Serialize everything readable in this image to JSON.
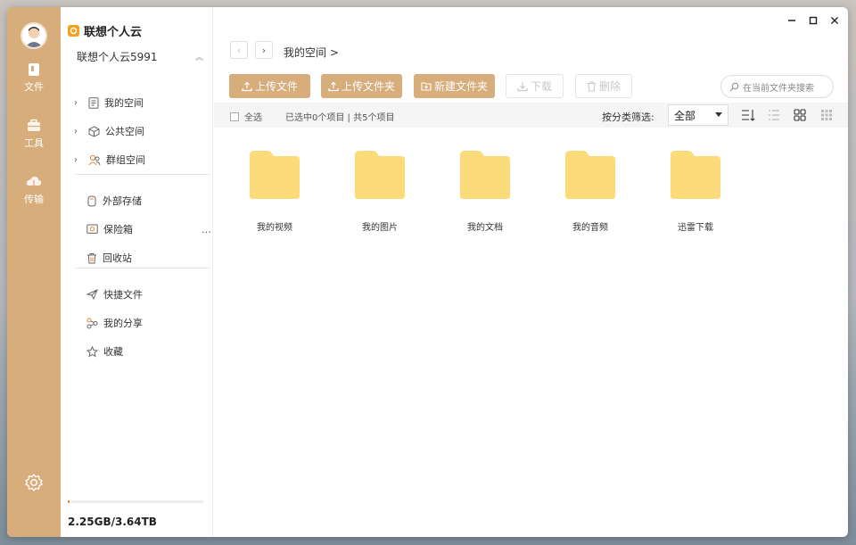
{
  "app": {
    "brand": "联想个人云",
    "account": "联想个人云5991"
  },
  "rail": [
    {
      "label": "文件",
      "icon": "file-icon"
    },
    {
      "label": "工具",
      "icon": "toolbox-icon"
    },
    {
      "label": "传输",
      "icon": "cloud-transfer-icon"
    }
  ],
  "sidebar": {
    "groups": [
      {
        "label": "我的空间",
        "icon": "document-icon"
      },
      {
        "label": "公共空间",
        "icon": "cube-icon"
      },
      {
        "label": "群组空间",
        "icon": "group-icon"
      }
    ],
    "storage_items": [
      {
        "label": "外部存储",
        "icon": "external-storage-icon"
      },
      {
        "label": "保险箱",
        "icon": "safe-icon"
      },
      {
        "label": "回收站",
        "icon": "trash-icon"
      }
    ],
    "more": "…",
    "quick_items": [
      {
        "label": "快捷文件",
        "icon": "send-icon"
      },
      {
        "label": "我的分享",
        "icon": "share-icon"
      },
      {
        "label": "收藏",
        "icon": "star-icon"
      }
    ],
    "storage": {
      "text": "2.25GB/3.64TB",
      "used_fraction": 0.006
    }
  },
  "main": {
    "breadcrumb": "我的空间 >",
    "toolbar": {
      "upload_file": "上传文件",
      "upload_folder": "上传文件夹",
      "new_folder": "新建文件夹",
      "download": "下载",
      "delete": "删除"
    },
    "search_placeholder": "在当前文件夹搜索",
    "filter": {
      "select_all": "全选",
      "selection_info": "已选中0个项目 | 共5个项目",
      "label": "按分类筛选:",
      "value": "全部"
    },
    "folders": [
      {
        "name": "我的视频"
      },
      {
        "name": "我的图片"
      },
      {
        "name": "我的文档"
      },
      {
        "name": "我的音频"
      },
      {
        "name": "迅雷下载"
      }
    ]
  },
  "colors": {
    "accent": "#d7ad7b",
    "folder": "#fbdb7a"
  }
}
